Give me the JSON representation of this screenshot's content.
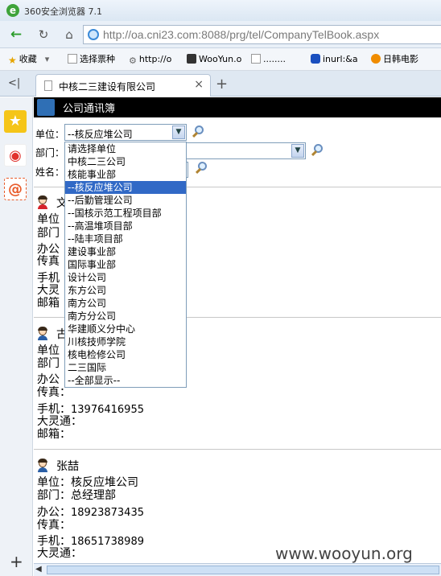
{
  "browser": {
    "app_title": "360安全浏览器 7.1",
    "url": "http://oa.cni23.com:8088/prg/tel/CompanyTelBook.aspx",
    "bookmarks": [
      {
        "label": "收藏",
        "icon": "star-icon"
      },
      {
        "label": "选择票种",
        "icon": "page-icon"
      },
      {
        "label": "http://o",
        "icon": "gear-icon"
      },
      {
        "label": "WooYun.o",
        "icon": "wooyun-icon"
      },
      {
        "label": "........",
        "icon": "page-icon"
      },
      {
        "label": "inurl:&a",
        "icon": "paw-icon"
      },
      {
        "label": "日韩电影",
        "icon": "play-icon"
      }
    ],
    "tab": {
      "label": "中核二三建设有限公司"
    }
  },
  "page": {
    "header_title": "公司通讯簿",
    "form": {
      "unit_label": "单位：",
      "unit_value": "--核反应堆公司",
      "dept_label": "部门：",
      "name_label": "姓名："
    },
    "dropdown_options": [
      "请选择单位",
      "中核二三公司",
      "核能事业部",
      "--核反应堆公司",
      "--后勤管理公司",
      "--国核示范工程项目部",
      "--高温堆项目部",
      "--陆丰项目部",
      "建设事业部",
      "国际事业部",
      "设计公司",
      "东方公司",
      "南方公司",
      "南方分公司",
      "华建顺义分中心",
      "川核技师学院",
      "核电检修公司",
      "二三国际",
      "--全部显示--"
    ],
    "selected_index": 3,
    "contacts": [
      {
        "name": "文",
        "unit_label": "单位",
        "dept_label": "部门",
        "office_label": "办公",
        "fax_label": "传真",
        "mobile_label": "手机",
        "lingtong_label": "大灵",
        "email_label": "邮箱"
      },
      {
        "name": "古",
        "unit_label": "单位",
        "dept_label": "部门",
        "office_label": "办公",
        "fax_label": "传真：",
        "mobile_label": "手机：",
        "mobile_value": "13976416955",
        "lingtong_label": "大灵通：",
        "email_label": "邮箱："
      },
      {
        "name": "张喆",
        "unit_label": "单位：",
        "unit_value": "核反应堆公司",
        "dept_label": "部门：",
        "dept_value": "总经理部",
        "office_label": "办公：",
        "office_value": "18923873435",
        "fax_label": "传真：",
        "mobile_label": "手机：",
        "mobile_value": "18651738989",
        "lingtong_label": "大灵通："
      }
    ]
  },
  "watermark": "www.wooyun.org"
}
